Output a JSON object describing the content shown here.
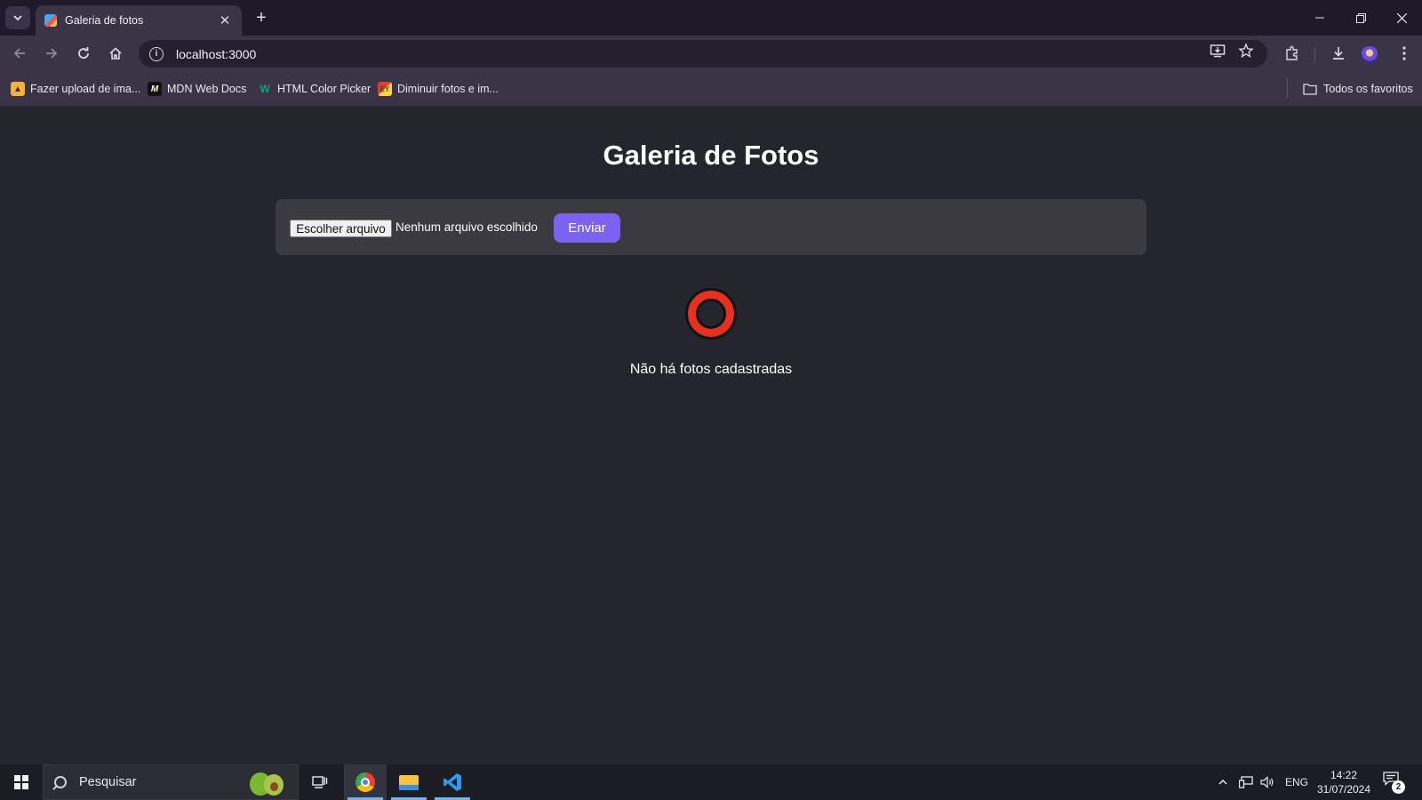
{
  "browser": {
    "tab_title": "Galeria de fotos",
    "url": "localhost:3000"
  },
  "bookmarks": [
    {
      "label": "Fazer upload de ima...",
      "icon": "upload-image-icon",
      "color": "#f2b33d"
    },
    {
      "label": "MDN Web Docs",
      "icon": "mdn-icon",
      "color": "#111111"
    },
    {
      "label": "HTML Color Picker",
      "icon": "w3schools-icon",
      "color": "#04aa6d"
    },
    {
      "label": "Diminuir fotos e im...",
      "icon": "resize-photos-icon",
      "color": "#e53935"
    }
  ],
  "bookmarks_folder": "Todos os favoritos",
  "page": {
    "heading": "Galeria de Fotos",
    "file_button": "Escolher arquivo",
    "file_status": "Nenhum arquivo escolhido",
    "send_button": "Enviar",
    "empty_message": "Não há fotos cadastradas"
  },
  "taskbar": {
    "search_placeholder": "Pesquisar",
    "language": "ENG",
    "time": "14:22",
    "date": "31/07/2024",
    "notification_count": "2"
  },
  "colors": {
    "page_bg": "#25252e",
    "panel_bg": "#3a3a40",
    "accent_button": "#7b62f0",
    "ring_red": "#e8301f"
  }
}
